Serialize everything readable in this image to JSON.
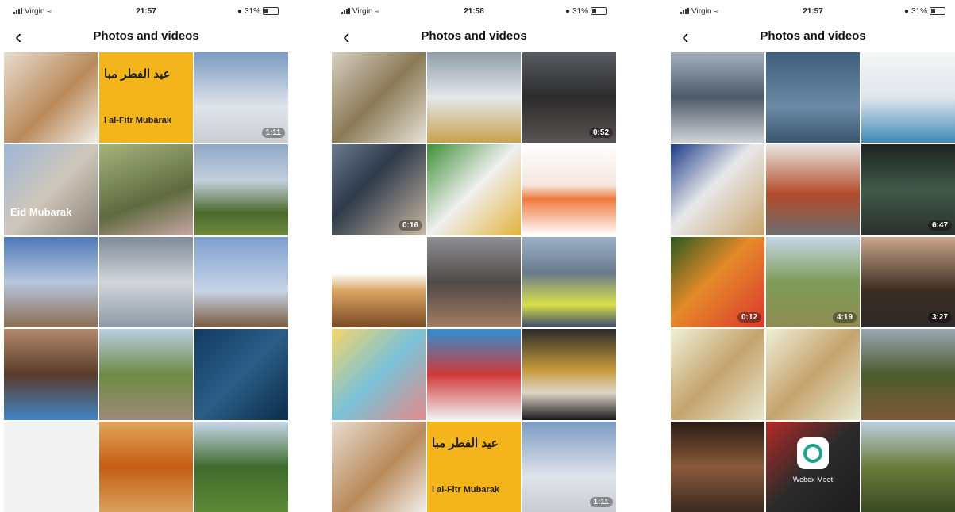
{
  "screens": [
    {
      "carrier": "Virgin",
      "time": "21:57",
      "battery": "31%",
      "title": "Photos and videos",
      "tiles": [
        {
          "bg": "linear-gradient(135deg,#e7dccf,#b98a5a 55%,#f2eee8)",
          "badge": ""
        },
        {
          "bg": "#f4b41c",
          "arabic": "عيد الفطر مبا",
          "eid": "l al-Fitr Mubarak",
          "badge": ""
        },
        {
          "bg": "linear-gradient(180deg,#7a9bc3,#dfe3ea 60%,#c9ccd3)",
          "badge": "1:11"
        },
        {
          "bg": "linear-gradient(135deg,#9cb6d6,#cfc7bb 50%,#8a8376)",
          "caption": "Eid Mubarak",
          "badge": ""
        },
        {
          "bg": "linear-gradient(160deg,#a5b37d,#5f6b3f 60%,#c7a6a4)",
          "badge": ""
        },
        {
          "bg": "linear-gradient(180deg,#8fa8c7,#c3cfdc 40%,#4b6a2c 75%,#6f8a3d)",
          "badge": ""
        },
        {
          "bg": "linear-gradient(180deg,#4d78b8,#b7c7dd 50%,#8a6c52)",
          "badge": ""
        },
        {
          "bg": "linear-gradient(180deg,#7e8a98,#d2d6da 50%,#8d9aa6)",
          "badge": ""
        },
        {
          "bg": "linear-gradient(180deg,#7ea0cf,#c7d4e6 60%,#7b5a3f)",
          "badge": ""
        },
        {
          "bg": "linear-gradient(180deg,#b38a6c,#5a3b29 50%,#3f86c7)",
          "badge": ""
        },
        {
          "bg": "linear-gradient(180deg,#b9cfe3,#6f8b43 50%,#9c8a79)",
          "badge": ""
        },
        {
          "bg": "linear-gradient(135deg,#123a63,#2a5e86 50%,#0d2c4a)",
          "badge": ""
        },
        {
          "bg": "#f3f3f3",
          "badge": ""
        },
        {
          "bg": "linear-gradient(180deg,#e1a55a,#c45e14 50%,#d9a15c)",
          "badge": ""
        },
        {
          "bg": "linear-gradient(180deg,#c7d7e8,#3f6b2e 50%,#5d8a34)",
          "badge": ""
        }
      ]
    },
    {
      "carrier": "Virgin",
      "time": "21:58",
      "battery": "31%",
      "title": "Photos and videos",
      "tiles": [
        {
          "bg": "linear-gradient(135deg,#d8cfc3,#8a7a55 50%,#e7e1d6)",
          "badge": ""
        },
        {
          "bg": "linear-gradient(180deg,#8f9ea7,#e5e7e9 50%,#c8a24e)",
          "badge": ""
        },
        {
          "bg": "linear-gradient(180deg,#585c62,#2c2b2b 50%,#5a5453)",
          "badge": "0:52"
        },
        {
          "bg": "linear-gradient(135deg,#6b7a8f,#2e3a4a 40%,#c9b9a3)",
          "badge": "0:16"
        },
        {
          "bg": "linear-gradient(135deg,#3f8f3a,#f0f0f0 50%,#e3b23c)",
          "badge": ""
        },
        {
          "bg": "linear-gradient(180deg,#ffffff,#f4e6dd 45%,#ef7a3d 60%,#ffffff)",
          "badge": ""
        },
        {
          "bg": "linear-gradient(180deg,#ffffff 40%,#d9a361 60%,#7a4b25)",
          "badge": ""
        },
        {
          "bg": "linear-gradient(180deg,#8e8f94,#4f4a46 50%,#a17c62)",
          "badge": ""
        },
        {
          "bg": "linear-gradient(180deg,#9ab0c8,#6a7b8c 40%,#d9e04a 75%,#3a4a6b)",
          "badge": ""
        },
        {
          "bg": "linear-gradient(135deg,#f5d56a,#79c2d8 50%,#e48a8a)",
          "badge": ""
        },
        {
          "bg": "linear-gradient(180deg,#2e8fd0,#d03a3a 50%,#f2f2f2)",
          "badge": ""
        },
        {
          "bg": "linear-gradient(180deg,#2a2a2a,#c79a3a 45%,#ddd6c8 70%,#1a1a1a)",
          "badge": ""
        },
        {
          "bg": "linear-gradient(135deg,#e7dccf,#b98a5a 55%,#f2eee8)",
          "badge": ""
        },
        {
          "bg": "#f4b41c",
          "arabic": "عيد الفطر مبا",
          "eid": "l al-Fitr Mubarak",
          "badge": ""
        },
        {
          "bg": "linear-gradient(180deg,#7a9bc3,#dfe3ea 60%,#c9ccd3)",
          "badge": "1:11"
        }
      ]
    },
    {
      "carrier": "Virgin",
      "time": "21:57",
      "battery": "31%",
      "title": "Photos and videos",
      "tiles": [
        {
          "bg": "linear-gradient(180deg,#a4afc0,#4e5a68 50%,#cfd3d8)",
          "badge": ""
        },
        {
          "bg": "linear-gradient(180deg,#3f5e7c,#6b8aa5 60%,#3a566f)",
          "badge": ""
        },
        {
          "bg": "linear-gradient(180deg,#f5f6f6,#dfe6ec 50%,#3f8ab5)",
          "badge": ""
        },
        {
          "bg": "linear-gradient(135deg,#1c3c86,#e8e8ec 45%,#c9a46a)",
          "badge": ""
        },
        {
          "bg": "linear-gradient(180deg,#e9e6e2,#b34a2a 55%,#6b6e6f)",
          "badge": ""
        },
        {
          "bg": "linear-gradient(180deg,#1e2320,#3f5a4b 50%,#2c302c)",
          "badge": "6:47"
        },
        {
          "bg": "linear-gradient(135deg,#2d5a20,#e68a2a 45%,#d9372b)",
          "badge": "0:12"
        },
        {
          "bg": "linear-gradient(180deg,#c7d6e6,#7e9c58 50%,#8f8b52)",
          "badge": "4:19"
        },
        {
          "bg": "linear-gradient(180deg,#c9a58a,#3b2c22 60%,#2c2a28)",
          "badge": "3:27"
        },
        {
          "bg": "linear-gradient(135deg,#eef0d8,#c6a36d 50%,#e6e9cf)",
          "badge": ""
        },
        {
          "bg": "linear-gradient(135deg,#eef0d8,#c6a36d 50%,#e6e9cf)",
          "badge": ""
        },
        {
          "bg": "linear-gradient(180deg,#9aa7b4,#4c5b2c 50%,#7a5a3a)",
          "badge": ""
        },
        {
          "bg": "linear-gradient(180deg,#2a1c14,#8a5a3a 50%,#3a2a20)",
          "badge": ""
        },
        {
          "bg": "linear-gradient(135deg,#b52a26,#2b2b2b 50%,#1d1d1d)",
          "app": "Webex Meet",
          "badge": ""
        },
        {
          "bg": "linear-gradient(180deg,#bdd0e0,#6a7d3c 50%,#3a4a22)",
          "badge": ""
        }
      ]
    }
  ]
}
